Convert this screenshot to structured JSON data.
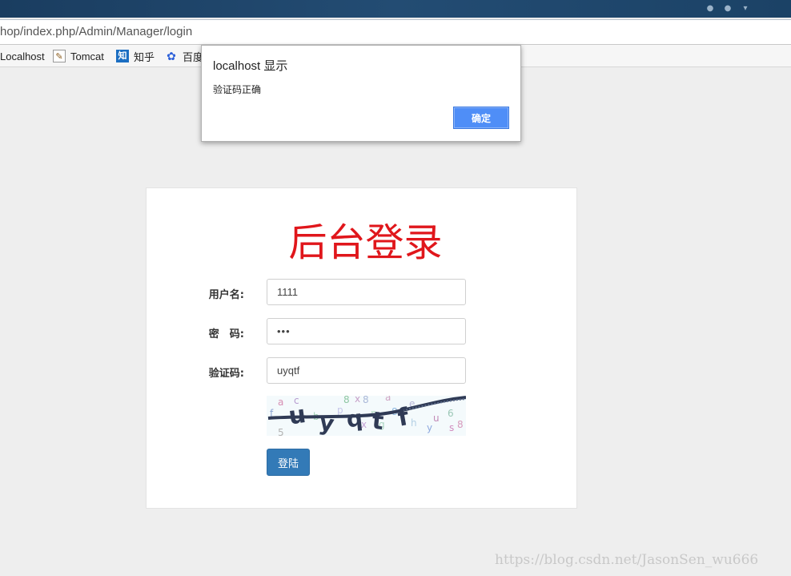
{
  "browser": {
    "url": "hop/index.php/Admin/Manager/login",
    "bookmarks": [
      {
        "label": "Localhost",
        "icon": "none"
      },
      {
        "label": "Tomcat",
        "icon": "tomcat-icon"
      },
      {
        "label": "知乎",
        "icon": "zhihu-icon",
        "glyph": "知"
      },
      {
        "label": "百度",
        "icon": "baidu-paw-icon"
      }
    ]
  },
  "dialog": {
    "title": "localhost 显示",
    "message": "验证码正确",
    "ok_label": "确定",
    "ok_color": "#4f8ef7"
  },
  "login": {
    "title": "后台登录",
    "title_color": "#e0161b",
    "username_label": "用户名:",
    "username_value": "1111",
    "password_label": "密　码:",
    "password_value": "•••",
    "captcha_label": "验证码:",
    "captcha_value": "uyqtf",
    "submit_label": "登陆",
    "submit_color": "#337ab7"
  },
  "watermark": "https://blog.csdn.net/JasonSen_wu666"
}
